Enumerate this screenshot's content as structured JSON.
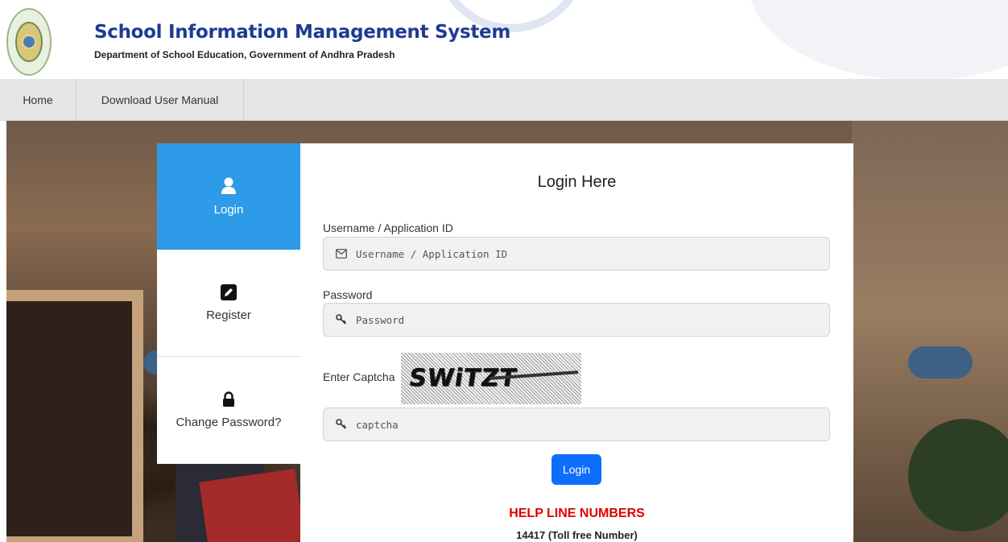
{
  "header": {
    "title": "School Information Management System",
    "subtitle": "Department of School Education, Government of Andhra Pradesh"
  },
  "nav": {
    "items": [
      {
        "label": "Home"
      },
      {
        "label": "Download User Manual"
      }
    ]
  },
  "side_tabs": [
    {
      "label": "Login",
      "icon": "user-icon",
      "active": true
    },
    {
      "label": "Register",
      "icon": "edit-icon",
      "active": false
    },
    {
      "label": "Change Password?",
      "icon": "lock-icon",
      "active": false
    }
  ],
  "login": {
    "title": "Login Here",
    "username_label": "Username / Application ID",
    "username_placeholder": "Username / Application ID",
    "username_icon": "envelope-icon",
    "password_label": "Password",
    "password_placeholder": "Password",
    "password_icon": "key-icon",
    "captcha_label": "Enter Captcha",
    "captcha_code": "SWiTZT",
    "captcha_placeholder": "captcha",
    "captcha_icon": "key-icon",
    "button_label": "Login"
  },
  "help": {
    "title": "HELP LINE NUMBERS",
    "number": "14417 (Toll free Number)"
  },
  "colors": {
    "brand_title": "#1f3a93",
    "active_tab": "#2e9be9",
    "login_button": "#0d6efd",
    "help_title": "#e00000"
  }
}
